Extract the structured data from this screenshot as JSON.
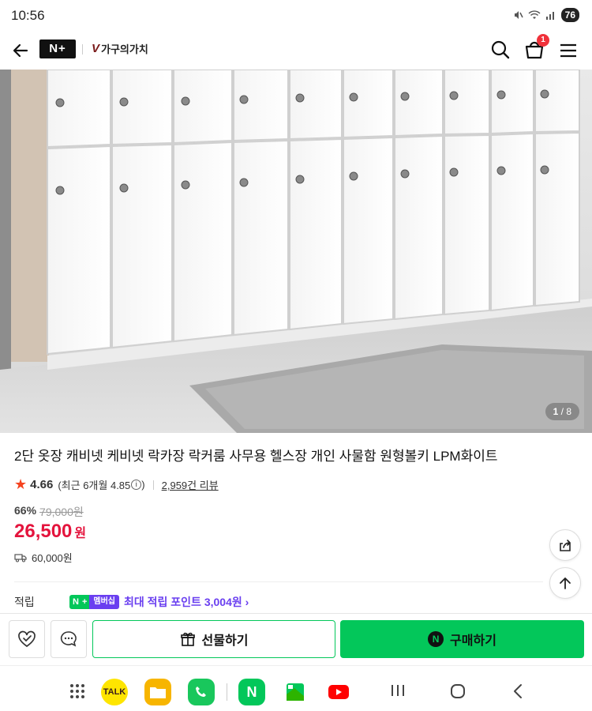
{
  "status_bar": {
    "time": "10:56",
    "battery": "76"
  },
  "header": {
    "logo": "N+",
    "brand_mark": "V",
    "brand_name": "가구의가치",
    "cart_count": "1"
  },
  "hero": {
    "image_index": "1",
    "image_total": "/ 8"
  },
  "product": {
    "title": "2단 옷장 캐비넷 케비넷 락카장 락커룸 사무용 헬스장 개인 사물함 원형볼키 LPM화이트",
    "rating": "4.66",
    "recent_rating_text": "(최근 6개월 4.85",
    "info_glyph": "i",
    "close_paren": ")",
    "review_count": "2,959건 리뷰",
    "discount_rate": "66%",
    "original_price": "79,000원",
    "price": "26,500",
    "price_unit": "원",
    "shipping": "60,000원"
  },
  "points": {
    "label": "적립",
    "badge_n": "N",
    "badge_plus": "+",
    "badge_membership": "멤버십",
    "text": "최대 적립 포인트 3,004원 ›"
  },
  "actions": {
    "gift_label": "선물하기",
    "buy_label": "구매하기",
    "buy_icon": "N"
  },
  "navbar": {
    "apps": [
      "kakaotalk",
      "files",
      "phone",
      "naver",
      "naver-maps",
      "youtube"
    ],
    "talk_label": "TALK",
    "naver_label": "N"
  },
  "colors": {
    "accent_green": "#03c75a",
    "price_red": "#e4143d",
    "star": "#f5431f",
    "membership_purple": "#6a3ff0"
  }
}
